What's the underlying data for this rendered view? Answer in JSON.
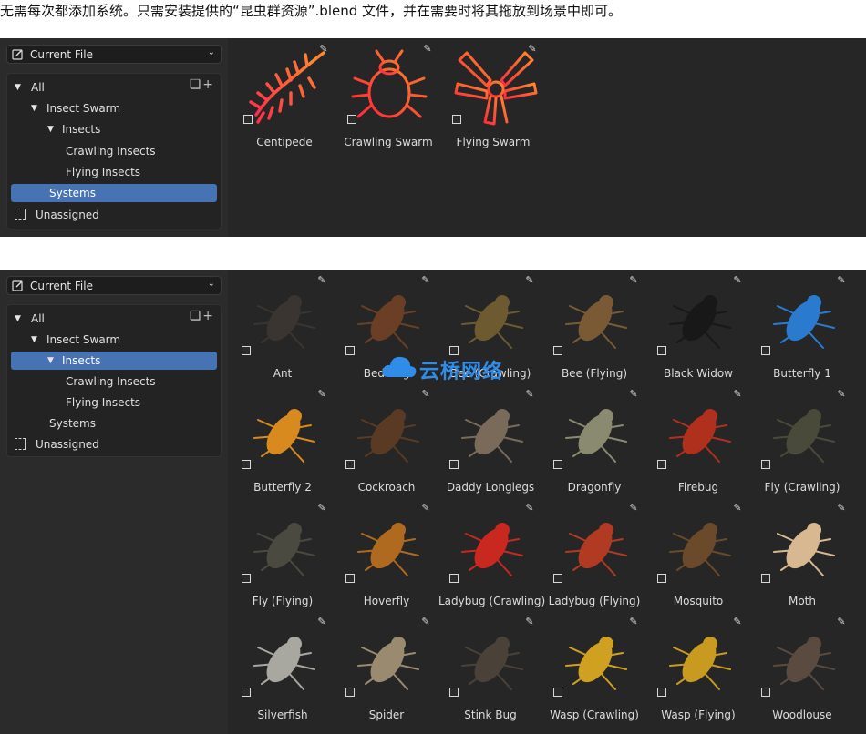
{
  "caption": "无需每次都添加系统。只需安装提供的“昆虫群资源”.blend 文件，并在需要时将其拖放到场景中即可。",
  "colors": {
    "panel_bg": "#262626",
    "active_row": "#4772b3",
    "neon_red": "#ff3a2e",
    "neon_orange": "#ff7a2e"
  },
  "panel1": {
    "selector": {
      "label": "Current File",
      "icon": "asset-library-icon"
    },
    "tree": {
      "all": "All",
      "insect_swarm": "Insect Swarm",
      "insects": "Insects",
      "crawling": "Crawling Insects",
      "flying": "Flying Insects",
      "systems": "Systems",
      "unassigned": "Unassigned",
      "active_item": "Systems"
    },
    "assets": [
      {
        "name": "Centipede",
        "icon": "centipede-icon"
      },
      {
        "name": "Crawling Swarm",
        "icon": "beetle-icon"
      },
      {
        "name": "Flying Swarm",
        "icon": "flying-insect-icon"
      }
    ]
  },
  "panel2": {
    "selector": {
      "label": "Current File",
      "icon": "asset-library-icon"
    },
    "tree": {
      "all": "All",
      "insect_swarm": "Insect Swarm",
      "insects": "Insects",
      "crawling": "Crawling Insects",
      "flying": "Flying Insects",
      "systems": "Systems",
      "unassigned": "Unassigned",
      "active_item": "Insects"
    },
    "assets": [
      "Ant",
      "Bed Bug",
      "Bee (Crawling)",
      "Bee (Flying)",
      "Black Widow",
      "Butterfly 1",
      "Butterfly 2",
      "Cockroach",
      "Daddy Longlegs",
      "Dragonfly",
      "Firebug",
      "Fly (Crawling)",
      "Fly (Flying)",
      "Hoverfly",
      "Ladybug (Crawling)",
      "Ladybug (Flying)",
      "Mosquito",
      "Moth",
      "Silverfish",
      "Spider",
      "Stink Bug",
      "Wasp (Crawling)",
      "Wasp (Flying)",
      "Woodlouse"
    ]
  },
  "watermark": "云桥网络"
}
